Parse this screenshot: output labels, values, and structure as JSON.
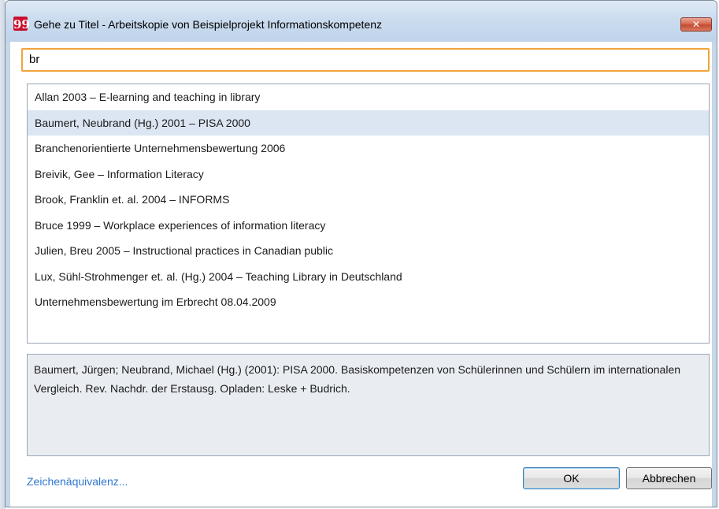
{
  "window": {
    "title": "Gehe zu Titel - Arbeitskopie von Beispielprojekt Informationskompetenz",
    "app_icon_glyph": "99",
    "close_glyph": "✕"
  },
  "search": {
    "value": "br"
  },
  "results": {
    "items": [
      "Allan 2003 – E-learning and teaching in library",
      "Baumert, Neubrand (Hg.) 2001 – PISA 2000",
      "Branchenorientierte Unternehmensbewertung 2006",
      "Breivik, Gee – Information Literacy",
      "Brook, Franklin et. al. 2004 – INFORMS",
      "Bruce 1999 – Workplace experiences of information literacy",
      "Julien, Breu 2005 – Instructional practices in Canadian public",
      "Lux, Sühl-Strohmenger et. al. (Hg.) 2004 – Teaching Library in Deutschland",
      "Unternehmensbewertung im Erbrecht 08.04.2009"
    ],
    "selected_index": 1
  },
  "detail": {
    "text": "Baumert, Jürgen; Neubrand, Michael (Hg.) (2001): PISA 2000. Basiskompetenzen von Schülerinnen und Schülern im internationalen Vergleich. Rev. Nachdr. der Erstausg. Opladen: Leske + Budrich."
  },
  "footer": {
    "link_label": "Zeichenäquivalenz...",
    "ok_label": "OK",
    "cancel_label": "Abbrechen"
  },
  "colors": {
    "accent_focus": "#f2a33c",
    "selection": "#dce6f2",
    "link": "#2f76d2",
    "app_icon": "#c8102e"
  }
}
